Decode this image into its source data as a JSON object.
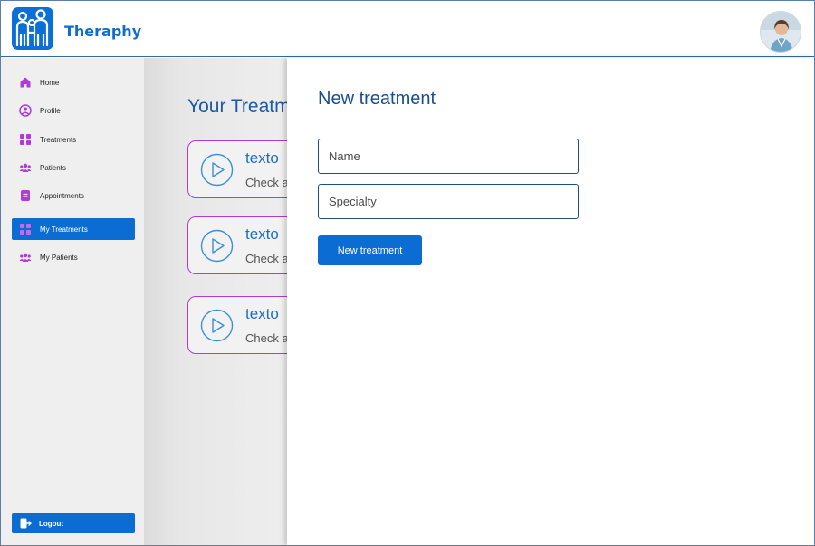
{
  "header": {
    "brand": "Theraphy",
    "logo_icon": "family-logo-icon",
    "avatar_icon": "user-avatar"
  },
  "sidebar": {
    "items": [
      {
        "label": "Home",
        "icon": "home-icon"
      },
      {
        "label": "Profile",
        "icon": "user-circle-icon"
      },
      {
        "label": "Treatments",
        "icon": "grid-icon"
      },
      {
        "label": "Patients",
        "icon": "users-icon"
      },
      {
        "label": "Appointments",
        "icon": "document-icon"
      },
      {
        "label": "My Treatments",
        "icon": "grid-icon",
        "active": true
      },
      {
        "label": "My Patients",
        "icon": "users-icon"
      }
    ],
    "logout_label": "Logout"
  },
  "main": {
    "title": "Your Treatm",
    "cards": [
      {
        "title": "texto",
        "subtitle": "Check a"
      },
      {
        "title": "texto",
        "subtitle": "Check a"
      },
      {
        "title": "texto",
        "subtitle": "Check a"
      }
    ]
  },
  "drawer": {
    "title": "New treatment",
    "name_placeholder": "Name",
    "specialty_placeholder": "Specialty",
    "submit_label": "New treatment"
  },
  "colors": {
    "primary": "#0b6dd4",
    "accent_purple": "#b33ad6",
    "title_blue": "#174f92"
  }
}
